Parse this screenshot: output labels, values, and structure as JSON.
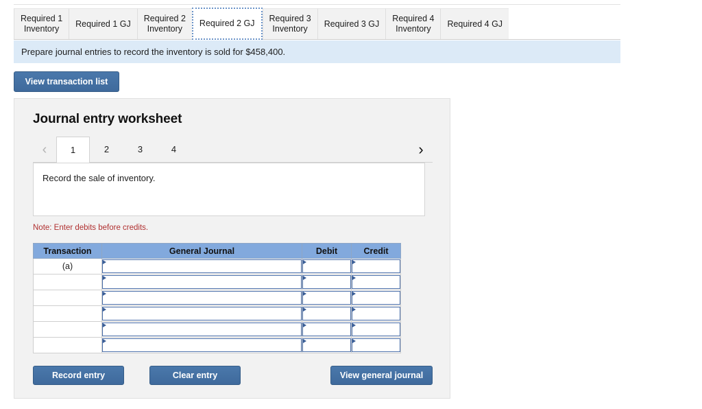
{
  "tabs": [
    {
      "label": "Required 1\nInventory",
      "active": false
    },
    {
      "label": "Required 1 GJ",
      "active": false
    },
    {
      "label": "Required 2\nInventory",
      "active": false
    },
    {
      "label": "Required 2 GJ",
      "active": true
    },
    {
      "label": "Required 3\nInventory",
      "active": false
    },
    {
      "label": "Required 3 GJ",
      "active": false
    },
    {
      "label": "Required 4\nInventory",
      "active": false
    },
    {
      "label": "Required 4 GJ",
      "active": false
    }
  ],
  "instruction": {
    "text": "Prepare journal entries to record the inventory is sold for $458,400."
  },
  "toolbar": {
    "view_transaction_list_label": "View transaction list"
  },
  "worksheet": {
    "title": "Journal entry worksheet",
    "pager": {
      "prev_icon": "‹",
      "next_icon": "›",
      "pages": [
        "1",
        "2",
        "3",
        "4"
      ],
      "active_page": "1"
    },
    "prompt": "Record the sale of inventory.",
    "note": "Note: Enter debits before credits.",
    "table": {
      "headers": [
        "Transaction",
        "General Journal",
        "Debit",
        "Credit"
      ],
      "rows": [
        {
          "transaction": "(a)",
          "general_journal": "",
          "debit": "",
          "credit": ""
        },
        {
          "transaction": "",
          "general_journal": "",
          "debit": "",
          "credit": ""
        },
        {
          "transaction": "",
          "general_journal": "",
          "debit": "",
          "credit": ""
        },
        {
          "transaction": "",
          "general_journal": "",
          "debit": "",
          "credit": ""
        },
        {
          "transaction": "",
          "general_journal": "",
          "debit": "",
          "credit": ""
        },
        {
          "transaction": "",
          "general_journal": "",
          "debit": "",
          "credit": ""
        }
      ]
    },
    "actions": {
      "record_entry_label": "Record entry",
      "clear_entry_label": "Clear entry",
      "view_general_journal_label": "View general journal"
    }
  },
  "colors": {
    "button_blue": "#43709f",
    "table_header_blue": "#82a9dd",
    "instruction_bar_blue": "#dceaf7",
    "panel_gray": "#f2f2f2",
    "note_red": "#b03030",
    "input_border_blue": "#4a6ea9"
  }
}
